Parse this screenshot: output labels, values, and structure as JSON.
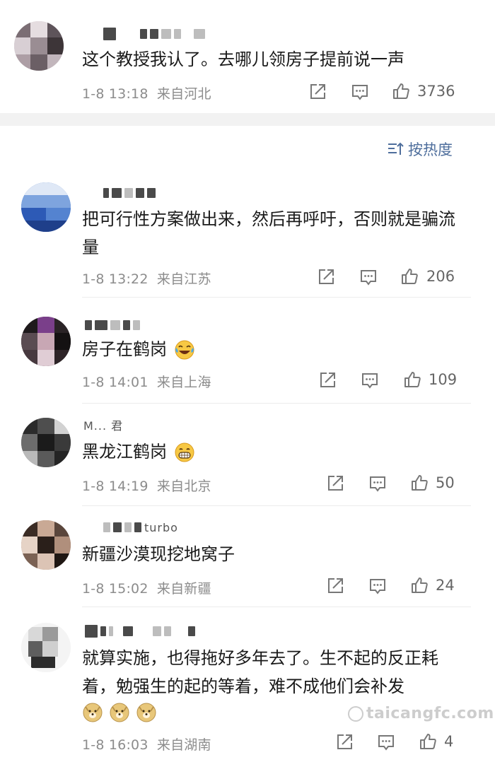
{
  "sort_label": "按热度",
  "watermark": "taicangfc.com",
  "comments": [
    {
      "text": "这个教授我认了。去哪儿领房子提前说一声",
      "time": "1-8 13:18",
      "location": "来自河北",
      "likes": "3736"
    },
    {
      "text": "把可行性方案做出来，然后再呼吁，否则就是骗流量",
      "time": "1-8 13:22",
      "location": "来自江苏",
      "likes": "206"
    },
    {
      "text": "房子在鹤岗",
      "emoji": "laugh-cry-emoji",
      "time": "1-8 14:01",
      "location": "来自上海",
      "likes": "109"
    },
    {
      "name": "M... 君",
      "text": "黑龙江鹤岗",
      "emoji": "grin-emoji",
      "time": "1-8 14:19",
      "location": "来自北京",
      "likes": "50"
    },
    {
      "name": "turbo",
      "text": "新疆沙漠现挖地窝子",
      "time": "1-8 15:02",
      "location": "来自新疆",
      "likes": "24"
    },
    {
      "text": "就算实施，也得拖好多年去了。生不起的反正耗着，勉强生的起的等着，难不成他们会补发",
      "emoji": "doge-emoji",
      "time": "1-8 16:03",
      "location": "来自湖南",
      "likes": "4"
    }
  ]
}
